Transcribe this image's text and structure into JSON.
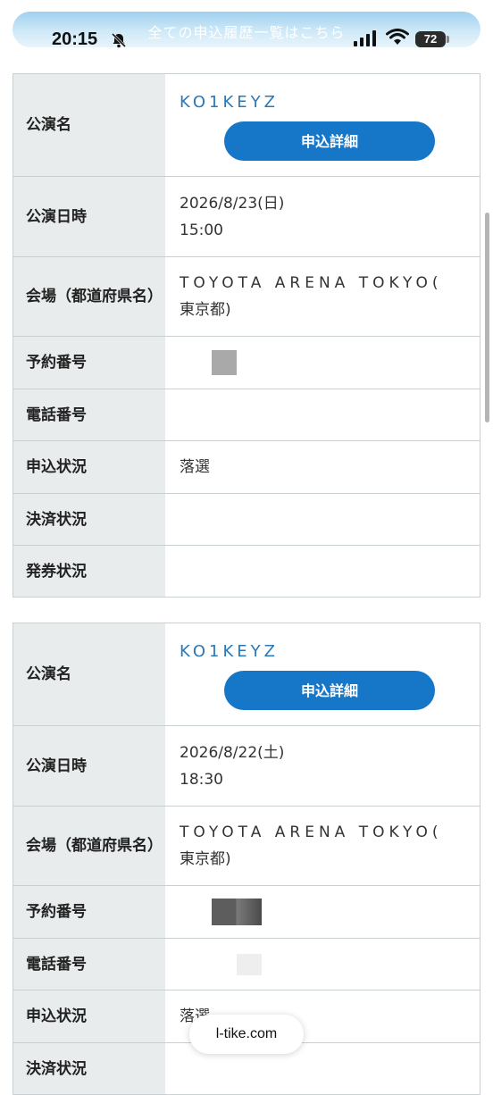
{
  "status_bar": {
    "time": "20:15",
    "battery": "72",
    "banner": "全ての申込履歴一覧はこちら"
  },
  "labels": {
    "performance": "公演名",
    "datetime": "公演日時",
    "venue": "会場（都道府県名）",
    "reservation": "予約番号",
    "phone": "電話番号",
    "application_status": "申込状況",
    "payment_status": "決済状況",
    "ticket_status": "発券状況"
  },
  "entries": [
    {
      "performance_name": "KO1KEYZ",
      "detail_button": "申込詳細",
      "date": "2026/8/23(日)",
      "time": "15:00",
      "venue_name": "TOYOTA ARENA TOKYO(",
      "venue_pref": "東京都)",
      "application_status": "落選",
      "payment_status": "",
      "ticket_status": ""
    },
    {
      "performance_name": "KO1KEYZ",
      "detail_button": "申込詳細",
      "date": "2026/8/22(土)",
      "time": "18:30",
      "venue_name": "TOYOTA ARENA TOKYO(",
      "venue_pref": "東京都)",
      "application_status": "落選"
    }
  ],
  "footer": {
    "domain": "l-tike.com"
  },
  "icons": {
    "bell": "bell-slash-icon",
    "signal": "cellular-signal-icon",
    "wifi": "wifi-icon",
    "battery": "battery-icon"
  }
}
